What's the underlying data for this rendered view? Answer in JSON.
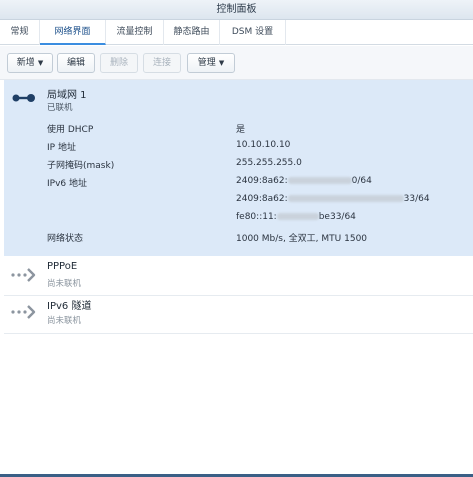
{
  "window": {
    "title": "控制面板"
  },
  "tabs": [
    {
      "label": "常规"
    },
    {
      "label": "网络界面"
    },
    {
      "label": "流量控制"
    },
    {
      "label": "静态路由"
    },
    {
      "label": "DSM 设置"
    }
  ],
  "active_tab": "网络界面",
  "toolbar": {
    "create_label": "新增",
    "edit_label": "编辑",
    "delete_label": "删除",
    "connect_label": "连接",
    "manage_label": "管理"
  },
  "interfaces": [
    {
      "name": "局域网 1",
      "status": "已联机",
      "details": [
        {
          "label": "使用 DHCP",
          "value": "是"
        },
        {
          "label": "IP 地址",
          "value": "10.10.10.10"
        },
        {
          "label": "子网掩码(mask)",
          "value": "255.255.255.0"
        },
        {
          "label": "IPv6 地址",
          "values": [
            "2409:8a62:",
            "0/64",
            "2409:8a62:",
            "33/64",
            "fe80::11:",
            "be33/64"
          ]
        },
        {
          "label": "网络状态",
          "value": "1000 Mb/s, 全双工, MTU 1500"
        }
      ]
    },
    {
      "name": "PPPoE",
      "status": "尚未联机"
    },
    {
      "name": "IPv6 隧道",
      "status": "尚未联机"
    }
  ],
  "icons": {
    "connected": "connected-node-icon",
    "disconnected": "disconnected-arrow-icon"
  },
  "colors": {
    "selected_bg": "#dce9f8",
    "accent": "#3a8de0",
    "icon_dark": "#1f3f66"
  }
}
